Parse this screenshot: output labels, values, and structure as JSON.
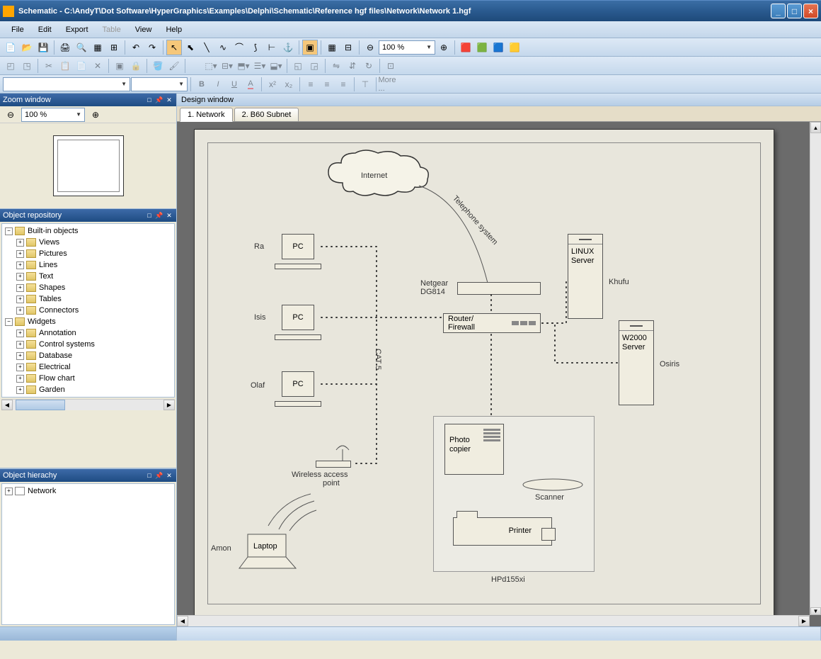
{
  "titlebar": {
    "text": "Schematic - C:\\AndyT\\Dot Software\\HyperGraphics\\Examples\\Delphi\\Schematic\\Reference hgf files\\Network\\Network 1.hgf"
  },
  "menu": {
    "file": "File",
    "edit": "Edit",
    "export": "Export",
    "table": "Table",
    "view": "View",
    "help": "Help"
  },
  "toolbar": {
    "zoom_value": "100 %",
    "more": "More ..."
  },
  "zoom_panel": {
    "title": "Zoom window",
    "value": "100 %"
  },
  "repo_panel": {
    "title": "Object repository",
    "root1": "Built-in objects",
    "views": "Views",
    "pictures": "Pictures",
    "lines": "Lines",
    "text": "Text",
    "shapes": "Shapes",
    "tables": "Tables",
    "connectors": "Connectors",
    "root2": "Widgets",
    "annotation": "Annotation",
    "control": "Control systems",
    "database": "Database",
    "electrical": "Electrical",
    "flowchart": "Flow chart",
    "garden": "Garden"
  },
  "hier_panel": {
    "title": "Object hierachy",
    "network": "Network"
  },
  "design": {
    "title": "Design window",
    "tab1": "1. Network",
    "tab2": "2. B60 Subnet"
  },
  "diagram": {
    "internet": "Internet",
    "telephone": "Telephone system",
    "pc": "PC",
    "ra": "Ra",
    "isis": "Isis",
    "olaf": "Olaf",
    "netgear": "Netgear",
    "dg814": "DG814",
    "router": "Router/",
    "firewall": "Firewall",
    "linux": "LINUX",
    "server": "Server",
    "khufu": "Khufu",
    "w2000": "W2000",
    "osiris": "Osiris",
    "cat5": "CAT 5",
    "wireless": "Wireless access",
    "point": "point",
    "amon": "Amon",
    "laptop": "Laptop",
    "photo": "Photo",
    "copier": "copier",
    "scanner": "Scanner",
    "printer": "Printer",
    "hpd": "HPd155xi"
  }
}
